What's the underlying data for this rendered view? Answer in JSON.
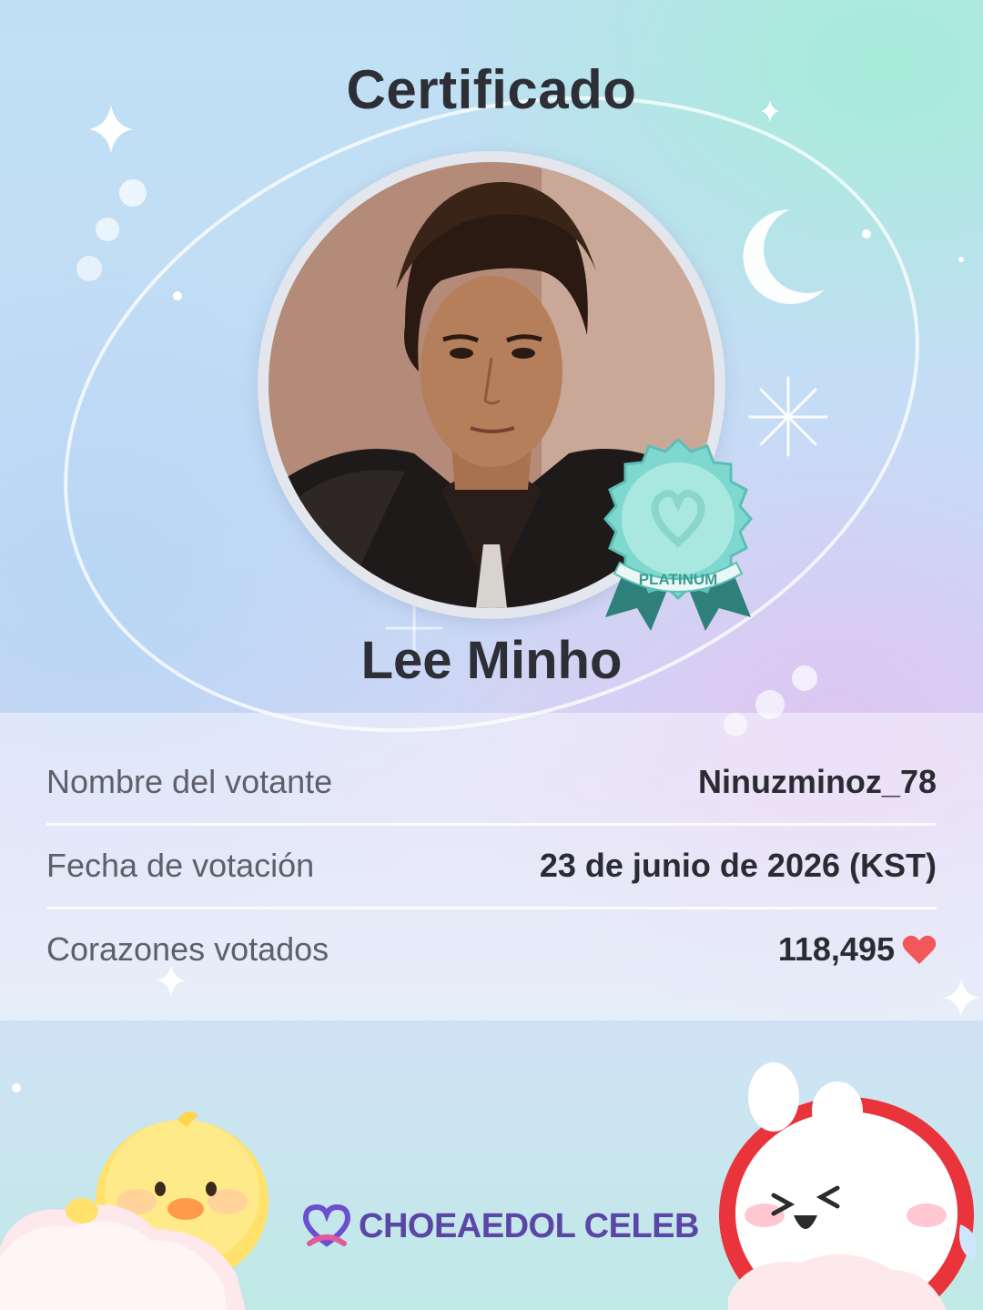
{
  "certificate": {
    "title": "Certificado",
    "celebrity_name": "Lee Minho",
    "badge_label": "PLATINUM"
  },
  "info": {
    "rows": [
      {
        "label": "Nombre del votante",
        "value": "Ninuzminoz_78"
      },
      {
        "label": "Fecha de votación",
        "value": "23 de junio de 2026 (KST)"
      },
      {
        "label": "Corazones votados",
        "value": "118,495"
      }
    ]
  },
  "brand": {
    "name": "CHOEAEDOL CELEB"
  },
  "icons": {
    "hearts": "heart-icon",
    "logo": "choeaedol-logo-icon",
    "badge": "platinum-ribbon-badge"
  },
  "colors": {
    "heart": "#f2575a",
    "badge": "#7fd8cf",
    "brand": "#5b46a8"
  }
}
